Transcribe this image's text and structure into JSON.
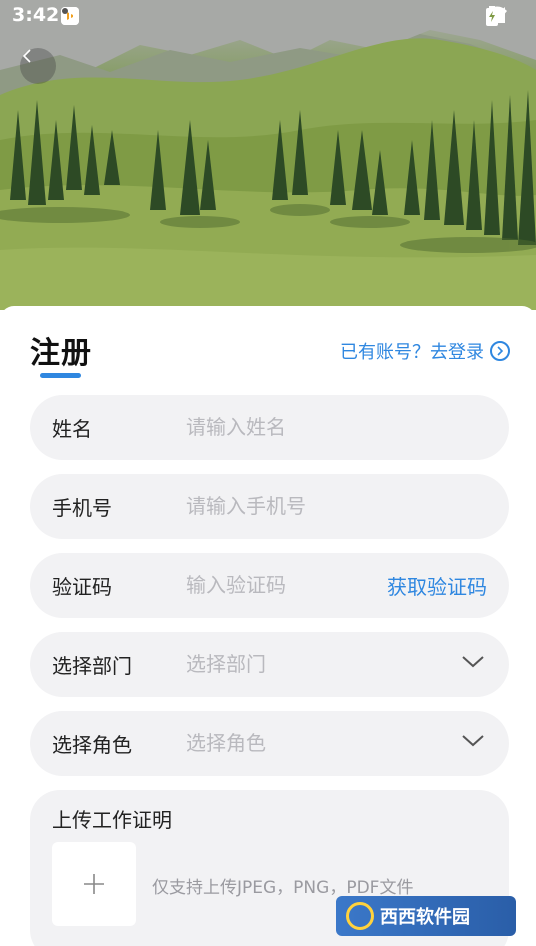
{
  "status_bar": {
    "time": "3:42",
    "icons": [
      "telegram-icon",
      "app-icon-1",
      "app-icon-2",
      "voice-wave-icon",
      "dot-icon",
      "wifi-icon",
      "signal-icon",
      "battery-charging-icon"
    ]
  },
  "colors": {
    "accent": "#2f87e0",
    "field_bg": "#f2f2f4",
    "placeholder": "#b9b9be"
  },
  "header": {
    "title": "注册",
    "login_link": "已有账号？去登录"
  },
  "form": {
    "name": {
      "label": "姓名",
      "placeholder": "请输入姓名",
      "value": ""
    },
    "phone": {
      "label": "手机号",
      "placeholder": "请输入手机号",
      "value": ""
    },
    "code": {
      "label": "验证码",
      "placeholder": "输入验证码",
      "value": "",
      "action": "获取验证码"
    },
    "department": {
      "label": "选择部门",
      "placeholder": "选择部门"
    },
    "role": {
      "label": "选择角色",
      "placeholder": "选择角色"
    }
  },
  "upload": {
    "title": "上传工作证明",
    "hint": "仅支持上传JPEG，PNG，PDF文件"
  },
  "watermark": {
    "text": "西西软件园"
  }
}
